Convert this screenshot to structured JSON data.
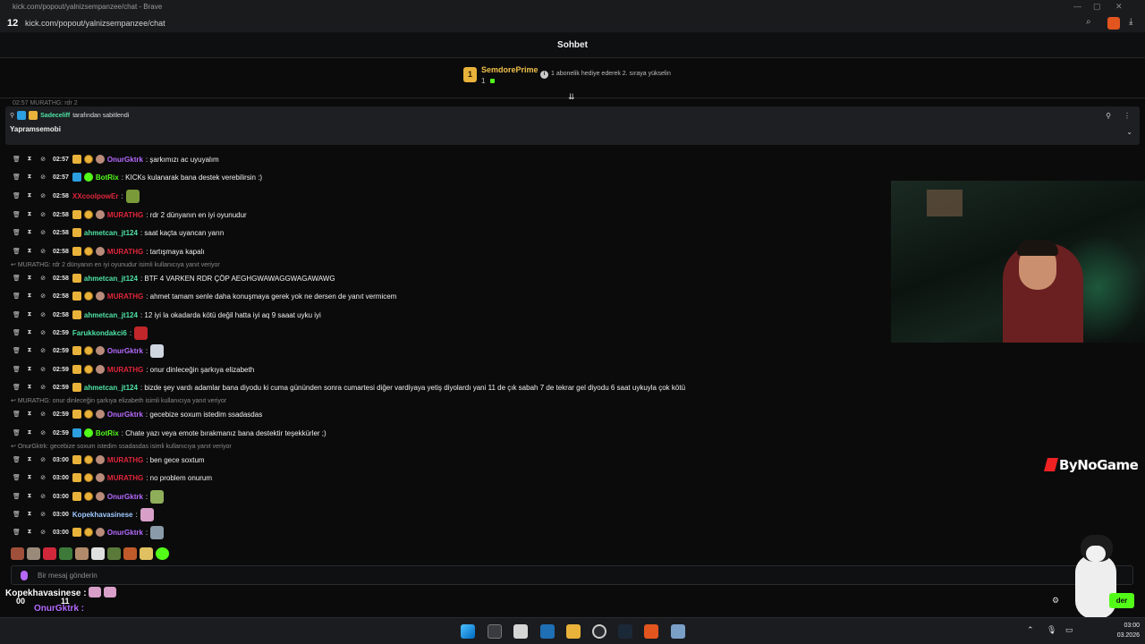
{
  "browser": {
    "title": "kick.com/popout/yalnizsempanzee/chat - Brave",
    "url": "kick.com/popout/yalnizsempanzee/chat",
    "overlay_badge": "12"
  },
  "chat": {
    "header_title": "Sohbet",
    "top_gifter": {
      "rank": "1",
      "name": "SemdorePrime",
      "count": "1",
      "prompt": "1 abonelik hediye ederek 2. sıraya yükselin"
    },
    "ghost_line": "02:57  MURATHG: rdr 2",
    "pinned": {
      "by_user": "Sadeceliff",
      "by_text": "tarafından sabitlendi",
      "message": "Yapramsemobi"
    },
    "messages": [
      {
        "time": "02:57",
        "user": "OnurGktrk",
        "color": "#b66bff",
        "badges": [
          "crown",
          "coin",
          "avatar"
        ],
        "text": ": şarkımızı ac uyuyalım"
      },
      {
        "time": "02:57",
        "user": "BotRix",
        "color": "#53fc18",
        "badges": [
          "mod",
          "ver"
        ],
        "text": ": KICKs kulanarak bana destek verebilirsin :)"
      },
      {
        "time": "02:58",
        "user": "XXcoolpowEr",
        "color": "#e0263a",
        "badges": [],
        "text": ":",
        "emote": "#7a9a3a"
      },
      {
        "time": "02:58",
        "user": "MURATHG",
        "color": "#e0263a",
        "badges": [
          "crown",
          "coin",
          "avatar"
        ],
        "text": ": rdr 2 dünyanın en iyi oyunudur"
      },
      {
        "time": "02:58",
        "user": "ahmetcan_jt124",
        "color": "#4ee3a4",
        "badges": [
          "crown"
        ],
        "text": ": saat kaçta uyancan yarın"
      },
      {
        "time": "02:58",
        "user": "MURATHG",
        "color": "#e0263a",
        "badges": [
          "crown",
          "coin",
          "avatar"
        ],
        "text": ": tartışmaya kapalı"
      },
      {
        "time": "02:58",
        "user": "ahmetcan_jt124",
        "color": "#4ee3a4",
        "badges": [
          "crown"
        ],
        "text": ": BTF 4 VARKEN RDR ÇÖP AEGHGWAWAGGWAGAWAWG"
      },
      {
        "time": "02:58",
        "user": "MURATHG",
        "color": "#e0263a",
        "badges": [
          "crown",
          "coin",
          "avatar"
        ],
        "text": ": ahmet tamam senle daha konuşmaya gerek yok ne dersen de yanıt vermicem"
      },
      {
        "time": "02:58",
        "user": "ahmetcan_jt124",
        "color": "#4ee3a4",
        "badges": [
          "crown"
        ],
        "text": ": 12 iyi la okadarda kötü değil hatta iyi aq 9 saaat uyku iyi"
      },
      {
        "time": "02:59",
        "user": "Farukkondakci6",
        "color": "#4ee3a4",
        "badges": [],
        "text": ":",
        "emote": "#c0262a"
      },
      {
        "time": "02:59",
        "user": "OnurGktrk",
        "color": "#b66bff",
        "badges": [
          "crown",
          "coin",
          "avatar"
        ],
        "text": ":",
        "emote": "#cfd6e0"
      },
      {
        "time": "02:59",
        "user": "MURATHG",
        "color": "#e0263a",
        "badges": [
          "crown",
          "coin",
          "avatar"
        ],
        "text": ": onur dinleceğin şarkıya elizabeth"
      },
      {
        "time": "02:59",
        "user": "ahmetcan_jt124",
        "color": "#4ee3a4",
        "badges": [
          "crown"
        ],
        "text": ": bizde şey vardı adamlar bana diyodu ki cuma gününden sonra cumartesi diğer vardiyaya yetiş diyolardı yani 11 de çık sabah 7 de tekrar gel diyodu 6 saat uykuyla çok kötü"
      },
      {
        "time": "02:59",
        "user": "OnurGktrk",
        "color": "#b66bff",
        "badges": [
          "crown",
          "coin",
          "avatar"
        ],
        "text": ": gecebize soxum istedim ssadasdas"
      },
      {
        "time": "02:59",
        "user": "BotRix",
        "color": "#53fc18",
        "badges": [
          "mod",
          "ver"
        ],
        "text": ": Chate yazı veya emote bırakmanız bana destektir teşekkürler ;)"
      },
      {
        "time": "03:00",
        "user": "MURATHG",
        "color": "#e0263a",
        "badges": [
          "crown",
          "coin",
          "avatar"
        ],
        "text": ": ben gece soxtum"
      },
      {
        "time": "03:00",
        "user": "MURATHG",
        "color": "#e0263a",
        "badges": [
          "crown",
          "coin",
          "avatar"
        ],
        "text": ": no problem onurum"
      },
      {
        "time": "03:00",
        "user": "OnurGktrk",
        "color": "#b66bff",
        "badges": [
          "crown",
          "coin",
          "avatar"
        ],
        "text": ":",
        "emote": "#8fae5a"
      },
      {
        "time": "03:00",
        "user": "Kopekhavasinese",
        "color": "#9ec9ff",
        "badges": [],
        "text": ":",
        "emote": "#d8a0c8"
      },
      {
        "time": "03:00",
        "user": "OnurGktrk",
        "color": "#b66bff",
        "badges": [
          "crown",
          "coin",
          "avatar"
        ],
        "text": ":",
        "emote": "#8a9aa8"
      }
    ],
    "replies": [
      "MURATHG: rdr 2 dünyanın en iyi oyunudur isimli kullanıcıya yanıt veriyor",
      "MURATHG: onur dinleceğin şarkıya elizabeth isimli kullanıcıya yanıt veriyor",
      "OnurGktrk: gecebize soxum istedim ssadasdas isimli kullanıcıya yanıt veriyor"
    ],
    "input_placeholder": "Bir mesaj gönderin",
    "send_label": "der"
  },
  "overlay": {
    "line1_user": "Kopekhavasinese :",
    "line2_user": "OnurGktrk :",
    "stat_a": "00",
    "stat_b": "11",
    "logo_text": "ByNoGame"
  },
  "taskbar": {
    "time": "03:00",
    "date": "03.2026"
  },
  "colors": {
    "kick_green": "#53fc18",
    "gold": "#e9b23a",
    "mod_blue": "#2b9fe0"
  }
}
